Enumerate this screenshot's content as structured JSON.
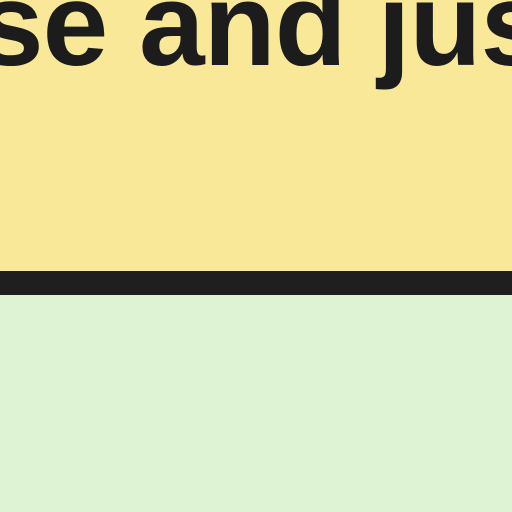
{
  "top_panel": {
    "text": "se and jus",
    "background": "#f9e897",
    "text_color": "#1c1c1c"
  },
  "divider": {
    "color": "#1f1f1f"
  },
  "bottom_panel": {
    "background": "#def3d4"
  }
}
